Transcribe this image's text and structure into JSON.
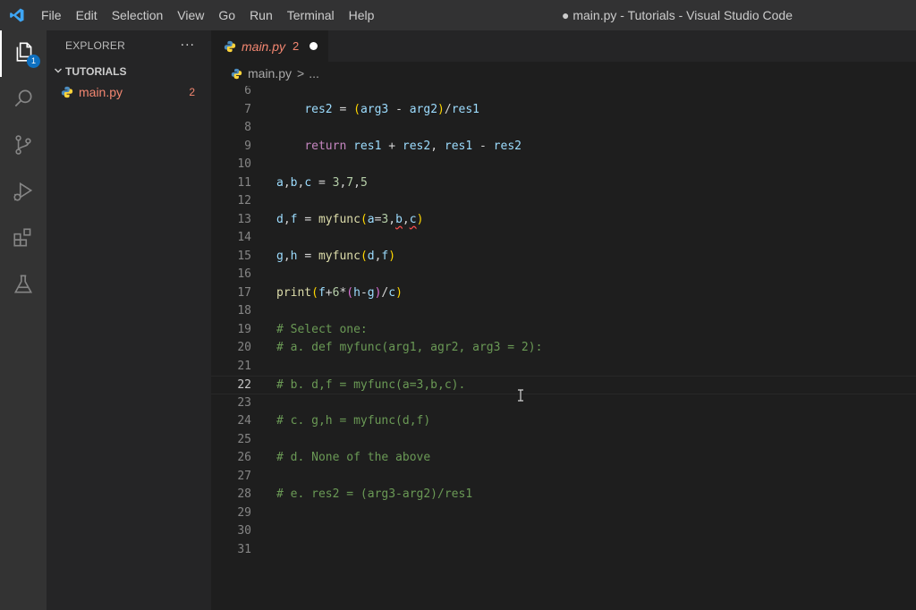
{
  "window": {
    "title": "● main.py - Tutorials - Visual Studio Code",
    "menu": [
      "File",
      "Edit",
      "Selection",
      "View",
      "Go",
      "Run",
      "Terminal",
      "Help"
    ]
  },
  "activity_bar": {
    "explorer_badge": "1"
  },
  "sidebar": {
    "title": "EXPLORER",
    "more": "···",
    "folder": "TUTORIALS",
    "file": {
      "name": "main.py",
      "problems": "2"
    }
  },
  "editor": {
    "tab": {
      "label": "main.py",
      "problems": "2"
    },
    "breadcrumb": {
      "file": "main.py",
      "sep": ">",
      "rest": "..."
    },
    "active_line": "22",
    "lines": [
      {
        "n": "6",
        "text": ""
      },
      {
        "n": "7",
        "text": "    res2 = (arg3 - arg2)/res1"
      },
      {
        "n": "8",
        "text": ""
      },
      {
        "n": "9",
        "text": "    return res1 + res2, res1 - res2"
      },
      {
        "n": "10",
        "text": ""
      },
      {
        "n": "11",
        "text": "a,b,c = 3,7,5"
      },
      {
        "n": "12",
        "text": ""
      },
      {
        "n": "13",
        "text": "d,f = myfunc(a=3,b,c)"
      },
      {
        "n": "14",
        "text": ""
      },
      {
        "n": "15",
        "text": "g,h = myfunc(d,f)"
      },
      {
        "n": "16",
        "text": ""
      },
      {
        "n": "17",
        "text": "print(f+6*(h-g)/c)"
      },
      {
        "n": "18",
        "text": ""
      },
      {
        "n": "19",
        "text": "# Select one:"
      },
      {
        "n": "20",
        "text": "# a. def myfunc(arg1, agr2, arg3 = 2):"
      },
      {
        "n": "21",
        "text": ""
      },
      {
        "n": "22",
        "text": "# b. d,f = myfunc(a=3,b,c)."
      },
      {
        "n": "23",
        "text": ""
      },
      {
        "n": "24",
        "text": "# c. g,h = myfunc(d,f)"
      },
      {
        "n": "25",
        "text": ""
      },
      {
        "n": "26",
        "text": "# d. None of the above"
      },
      {
        "n": "27",
        "text": ""
      },
      {
        "n": "28",
        "text": "# e. res2 = (arg3-arg2)/res1"
      },
      {
        "n": "29",
        "text": ""
      },
      {
        "n": "30",
        "text": ""
      },
      {
        "n": "31",
        "text": ""
      }
    ]
  },
  "colors": {
    "accent": "#0e70c0",
    "error": "#f48771",
    "comment": "#6a9955",
    "keyword": "#c586c0",
    "function": "#dcdcaa",
    "variable": "#9cdcfe",
    "number": "#b5cea8"
  }
}
